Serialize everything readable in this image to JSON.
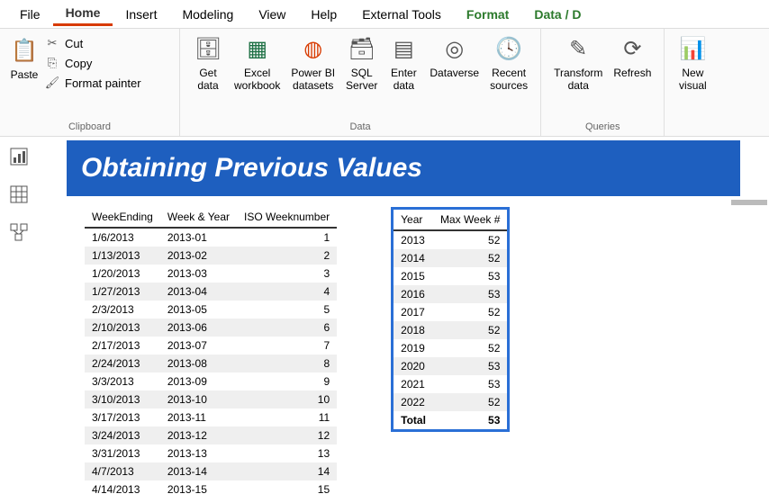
{
  "menu": {
    "file": "File",
    "home": "Home",
    "insert": "Insert",
    "modeling": "Modeling",
    "view": "View",
    "help": "Help",
    "external": "External Tools",
    "format": "Format",
    "datad": "Data / D"
  },
  "ribbon": {
    "paste": "Paste",
    "cut": "Cut",
    "copy": "Copy",
    "fpainter": "Format painter",
    "group_clip": "Clipboard",
    "getdata": "Get\ndata",
    "excelwb": "Excel\nworkbook",
    "pbids": "Power BI\ndatasets",
    "sqlsrv": "SQL\nServer",
    "enterd": "Enter\ndata",
    "dataverse": "Dataverse",
    "recent": "Recent\nsources",
    "group_data": "Data",
    "transform": "Transform\ndata",
    "refresh": "Refresh",
    "group_q": "Queries",
    "newvis": "New\nvisual"
  },
  "banner_title": "Obtaining Previous Values",
  "table1": {
    "headers": {
      "we": "WeekEnding",
      "wy": "Week & Year",
      "iso": "ISO Weeknumber"
    },
    "rows": [
      {
        "we": "1/6/2013",
        "wy": "2013-01",
        "iso": 1
      },
      {
        "we": "1/13/2013",
        "wy": "2013-02",
        "iso": 2
      },
      {
        "we": "1/20/2013",
        "wy": "2013-03",
        "iso": 3
      },
      {
        "we": "1/27/2013",
        "wy": "2013-04",
        "iso": 4
      },
      {
        "we": "2/3/2013",
        "wy": "2013-05",
        "iso": 5
      },
      {
        "we": "2/10/2013",
        "wy": "2013-06",
        "iso": 6
      },
      {
        "we": "2/17/2013",
        "wy": "2013-07",
        "iso": 7
      },
      {
        "we": "2/24/2013",
        "wy": "2013-08",
        "iso": 8
      },
      {
        "we": "3/3/2013",
        "wy": "2013-09",
        "iso": 9
      },
      {
        "we": "3/10/2013",
        "wy": "2013-10",
        "iso": 10
      },
      {
        "we": "3/17/2013",
        "wy": "2013-11",
        "iso": 11
      },
      {
        "we": "3/24/2013",
        "wy": "2013-12",
        "iso": 12
      },
      {
        "we": "3/31/2013",
        "wy": "2013-13",
        "iso": 13
      },
      {
        "we": "4/7/2013",
        "wy": "2013-14",
        "iso": 14
      },
      {
        "we": "4/14/2013",
        "wy": "2013-15",
        "iso": 15
      }
    ]
  },
  "table2": {
    "headers": {
      "year": "Year",
      "max": "Max Week #"
    },
    "rows": [
      {
        "year": "2013",
        "max": 52
      },
      {
        "year": "2014",
        "max": 52
      },
      {
        "year": "2015",
        "max": 53
      },
      {
        "year": "2016",
        "max": 53
      },
      {
        "year": "2017",
        "max": 52
      },
      {
        "year": "2018",
        "max": 52
      },
      {
        "year": "2019",
        "max": 52
      },
      {
        "year": "2020",
        "max": 53
      },
      {
        "year": "2021",
        "max": 53
      },
      {
        "year": "2022",
        "max": 52
      }
    ],
    "total": {
      "label": "Total",
      "value": 53
    }
  }
}
